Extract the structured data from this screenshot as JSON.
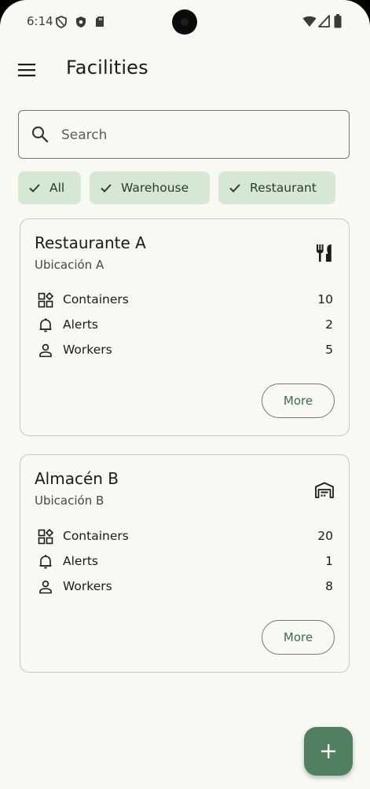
{
  "status_bar": {
    "time": "6:14",
    "left_icons": [
      "vpn-shield-icon",
      "shield-icon",
      "sd-card-icon"
    ],
    "right_icons": [
      "wifi-icon",
      "signal-icon",
      "battery-icon"
    ]
  },
  "app_bar": {
    "title": "Facilities",
    "menu_icon": "menu-icon"
  },
  "search": {
    "placeholder": "Search",
    "value": ""
  },
  "filters": [
    {
      "label": "All",
      "selected": true
    },
    {
      "label": "Warehouse",
      "selected": true
    },
    {
      "label": "Restaurant",
      "selected": true
    }
  ],
  "facilities": [
    {
      "name": "Restaurante A",
      "location": "Ubicación A",
      "type_icon": "restaurant-icon",
      "stats": [
        {
          "label": "Containers",
          "value": "10",
          "icon": "containers-icon"
        },
        {
          "label": "Alerts",
          "value": "2",
          "icon": "bell-icon"
        },
        {
          "label": "Workers",
          "value": "5",
          "icon": "person-icon"
        }
      ],
      "more_label": "More"
    },
    {
      "name": "Almacén B",
      "location": "Ubicación B",
      "type_icon": "warehouse-icon",
      "stats": [
        {
          "label": "Containers",
          "value": "20",
          "icon": "containers-icon"
        },
        {
          "label": "Alerts",
          "value": "1",
          "icon": "bell-icon"
        },
        {
          "label": "Workers",
          "value": "8",
          "icon": "person-icon"
        }
      ],
      "more_label": "More"
    }
  ],
  "fab": {
    "icon": "add-icon"
  },
  "colors": {
    "background": "#f8f9f2",
    "chip": "#d5e8d4",
    "accent": "#4f8060",
    "outline": "#72796f"
  }
}
